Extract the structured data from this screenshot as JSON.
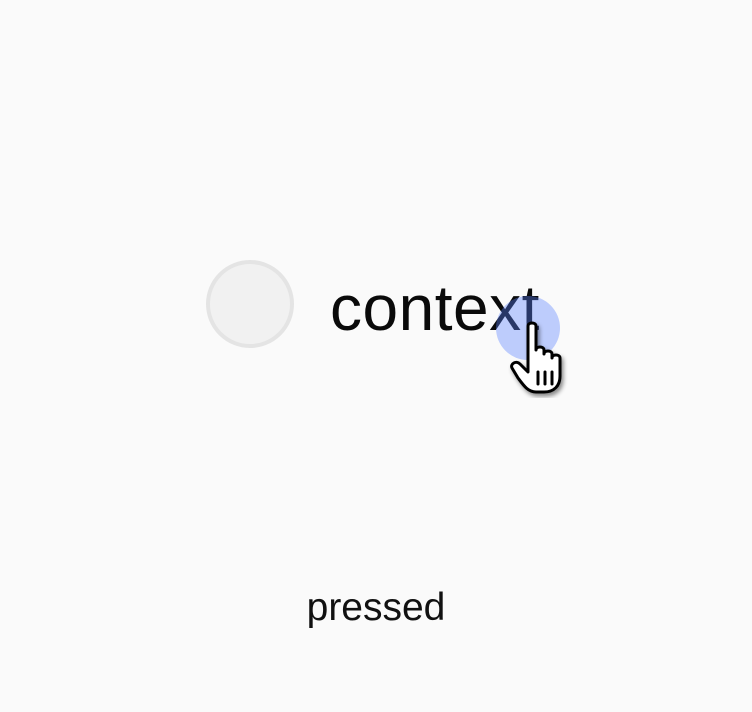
{
  "option": {
    "label": "context",
    "selected": false
  },
  "status": {
    "text": "pressed"
  },
  "cursor": {
    "icon": "hand-pointer-icon"
  },
  "colors": {
    "background": "#fafafa",
    "radio_border": "#e4e4e4",
    "radio_fill": "#f1f1f1",
    "click_halo": "#5a82ff"
  }
}
